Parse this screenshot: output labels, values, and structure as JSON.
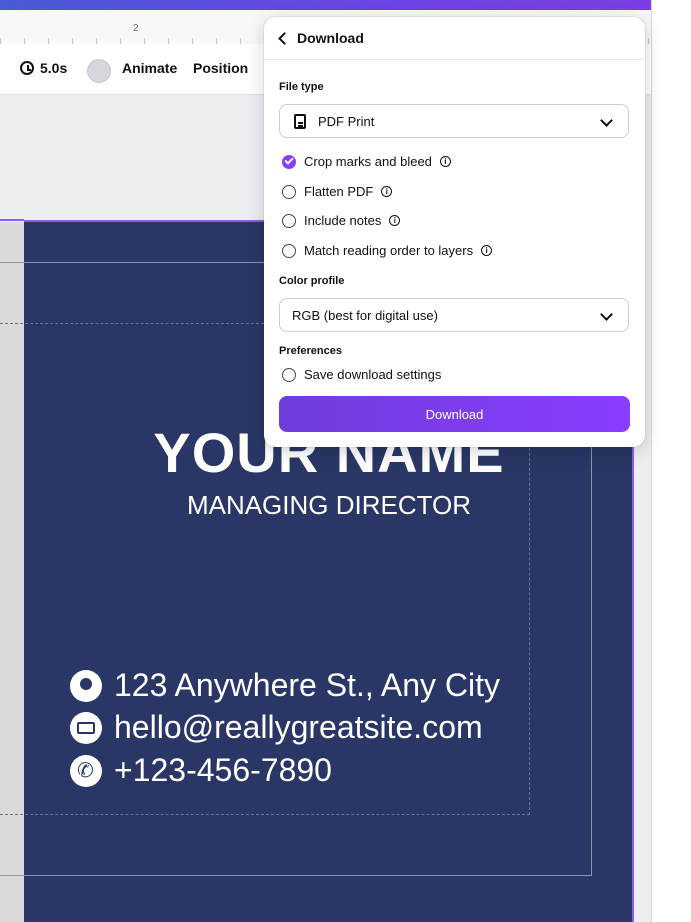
{
  "ruler": {
    "marker": "2"
  },
  "toolbar": {
    "duration": "5.0s",
    "animate": "Animate",
    "position": "Position"
  },
  "card": {
    "name": "YOUR NAME",
    "role": "MANAGING DIRECTOR",
    "address": "123 Anywhere St., Any City",
    "email": "hello@reallygreatsite.com",
    "phone": "+123-456-7890",
    "background_color": "#2a3766"
  },
  "download_panel": {
    "back_label": "Download",
    "file_type_label": "File type",
    "file_type_value": "PDF Print",
    "options": [
      {
        "label": "Crop marks and bleed",
        "checked": true
      },
      {
        "label": "Flatten PDF",
        "checked": false
      },
      {
        "label": "Include notes",
        "checked": false
      },
      {
        "label": "Match reading order to layers",
        "checked": false
      }
    ],
    "color_profile_label": "Color profile",
    "color_profile_value": "RGB (best for digital use)",
    "preferences_label": "Preferences",
    "save_settings_label": "Save download settings",
    "save_settings_checked": false,
    "download_button": "Download",
    "accent_color": "#8b3dff"
  }
}
